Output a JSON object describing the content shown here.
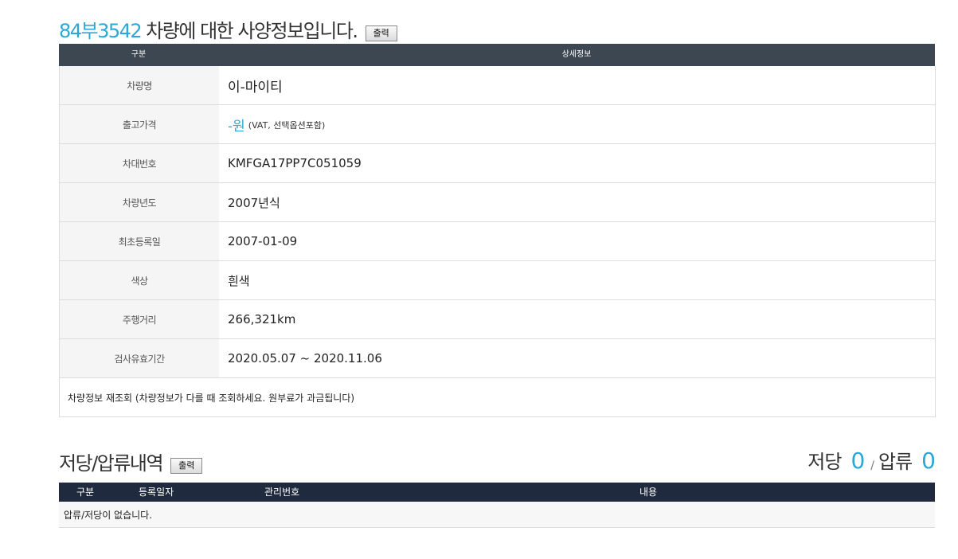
{
  "header": {
    "plate": "84부3542",
    "title_suffix": "차량에 대한 사양정보입니다.",
    "print_label": "출력"
  },
  "spec_table": {
    "col_category": "구분",
    "col_detail": "상세정보",
    "rows": [
      {
        "label": "차량명",
        "value": "이-마이티"
      },
      {
        "label": "출고가격",
        "value": "-원",
        "note": "(VAT, 선택옵션포함)"
      },
      {
        "label": "차대번호",
        "value": "KMFGA17PP7C051059"
      },
      {
        "label": "차량년도",
        "value": "2007년식"
      },
      {
        "label": "최초등록일",
        "value": "2007-01-09"
      },
      {
        "label": "색상",
        "value": "흰색"
      },
      {
        "label": "주행거리",
        "value": "266,321km"
      },
      {
        "label": "검사유효기간",
        "value": "2020.05.07 ~ 2020.11.06"
      }
    ],
    "refetch_text": "차량정보 재조회 (차량정보가 다를 때 조회하세요. 원부료가 과금됩니다)"
  },
  "lien": {
    "title": "저당/압류내역",
    "print_label": "출력",
    "mortgage_label": "저당",
    "mortgage_count": "0",
    "separator": "/",
    "seizure_label": "압류",
    "seizure_count": "0",
    "columns": [
      "구분",
      "등록일자",
      "관리번호",
      "내용"
    ],
    "empty_text": "압류/저당이 없습니다."
  }
}
